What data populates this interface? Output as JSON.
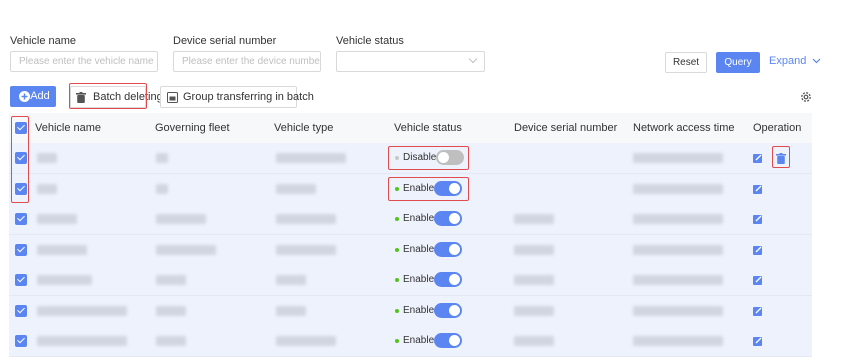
{
  "filters": {
    "vehicle_name": {
      "label": "Vehicle name",
      "placeholder": "Please enter the vehicle name"
    },
    "device_serial": {
      "label": "Device serial number",
      "placeholder": "Please enter the device number"
    },
    "vehicle_status": {
      "label": "Vehicle status",
      "value": ""
    }
  },
  "actions": {
    "reset": "Reset",
    "query": "Query",
    "expand": "Expand"
  },
  "toolbar": {
    "add": "Add",
    "batch_delete": "Batch deleting",
    "group_transfer": "Group transferring in batch",
    "settings_icon": "gear-icon"
  },
  "table": {
    "columns": [
      "Vehicle name",
      "Governing fleet",
      "Vehicle type",
      "Vehicle status",
      "Device serial number",
      "Network access time",
      "Operation"
    ],
    "rows": [
      {
        "status": "Disable",
        "enabled": false,
        "has_serial": false,
        "show_delete": true
      },
      {
        "status": "Enable",
        "enabled": true,
        "has_serial": false,
        "show_delete": false
      },
      {
        "status": "Enable",
        "enabled": true,
        "has_serial": true,
        "show_delete": false
      },
      {
        "status": "Enable",
        "enabled": true,
        "has_serial": true,
        "show_delete": false
      },
      {
        "status": "Enable",
        "enabled": true,
        "has_serial": true,
        "show_delete": false
      },
      {
        "status": "Enable",
        "enabled": true,
        "has_serial": true,
        "show_delete": false
      },
      {
        "status": "Enable",
        "enabled": true,
        "has_serial": true,
        "show_delete": false
      }
    ]
  },
  "colors": {
    "primary": "#5b86f2",
    "enable_dot": "#52c41a",
    "disable_toggle": "#bfbfbf",
    "highlight": "#e24b4b",
    "row_selected": "#eef2fd"
  }
}
